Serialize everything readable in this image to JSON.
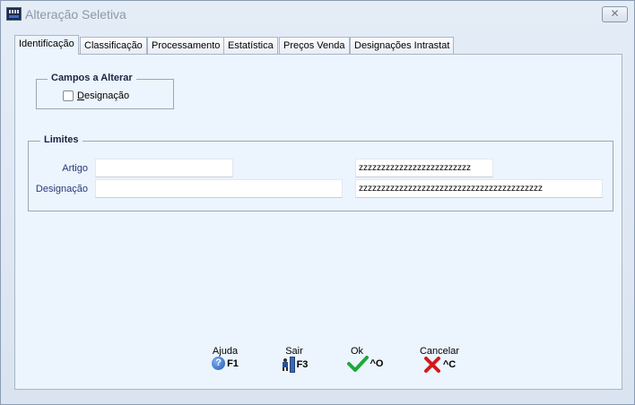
{
  "window": {
    "title": "Alteração Seletiva",
    "close_symbol": "✕"
  },
  "tabs": [
    {
      "label": "Identificação",
      "active": true
    },
    {
      "label": "Classificação",
      "active": false
    },
    {
      "label": "Processamento",
      "active": false
    },
    {
      "label": "Estatística",
      "active": false
    },
    {
      "label": "Preços Venda",
      "active": false
    },
    {
      "label": "Designações Intrastat",
      "active": false
    }
  ],
  "campos": {
    "title": "Campos a Alterar",
    "checkbox": {
      "label_first": "D",
      "label_rest": "esignação",
      "checked": false
    }
  },
  "limites": {
    "title": "Limites",
    "artigo": {
      "label": "Artigo",
      "from_value": "",
      "to_value": "zzzzzzzzzzzzzzzzzzzzzzzzz"
    },
    "designacao": {
      "label": "Designação",
      "from_value": "",
      "to_value": "zzzzzzzzzzzzzzzzzzzzzzzzzzzzzzzzzzzzzzzzz"
    }
  },
  "footer": {
    "ajuda": {
      "label": "Ajuda",
      "key": "F1",
      "icon": "help-icon"
    },
    "sair": {
      "label": "Sair",
      "key": "F3",
      "icon": "exit-icon"
    },
    "ok": {
      "label": "Ok",
      "key": "^O",
      "icon": "check-icon"
    },
    "cancelar": {
      "label": "Cancelar",
      "key": "^C",
      "icon": "cancel-x-icon"
    }
  },
  "colors": {
    "check": "#1fa83a",
    "cancel": "#d11a1a",
    "field_label": "#2a3a78",
    "panel": "#ecf4fd"
  }
}
